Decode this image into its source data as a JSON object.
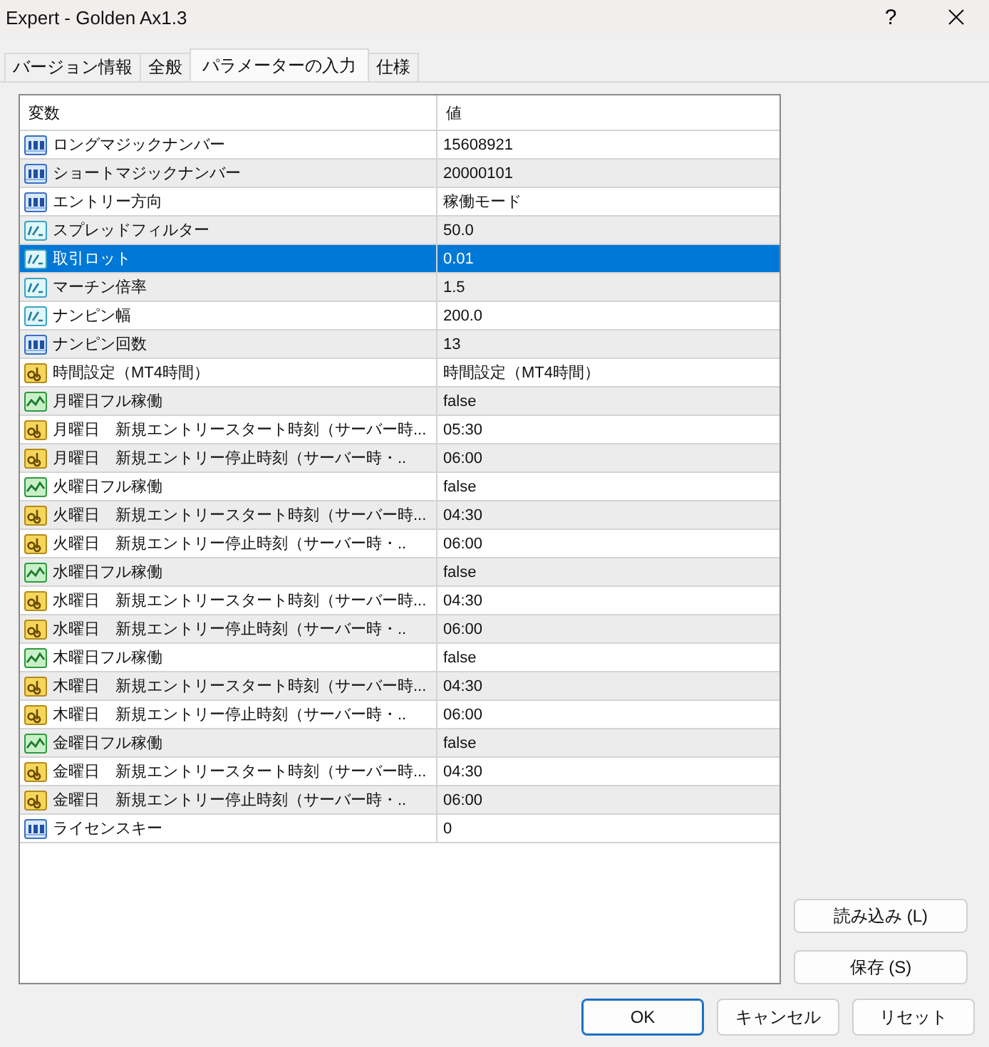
{
  "window": {
    "title": "Expert - Golden Ax1.3",
    "help_button": "?"
  },
  "tabs": [
    {
      "label": "バージョン情報",
      "selected": false
    },
    {
      "label": "全般",
      "selected": false
    },
    {
      "label": "パラメーターの入力",
      "selected": true
    },
    {
      "label": "仕様",
      "selected": false
    }
  ],
  "table": {
    "columns": [
      "変数",
      "値"
    ],
    "rows": [
      {
        "kind": "int",
        "name": "ロングマジックナンバー",
        "value": "15608921",
        "selected": false
      },
      {
        "kind": "int",
        "name": "ショートマジックナンバー",
        "value": "20000101",
        "selected": false
      },
      {
        "kind": "int",
        "name": "エントリー方向",
        "value": "稼働モード",
        "selected": false
      },
      {
        "kind": "double",
        "name": "スプレッドフィルター",
        "value": "50.0",
        "selected": false
      },
      {
        "kind": "double",
        "name": "取引ロット",
        "value": "0.01",
        "selected": true
      },
      {
        "kind": "double",
        "name": "マーチン倍率",
        "value": "1.5",
        "selected": false
      },
      {
        "kind": "double",
        "name": "ナンピン幅",
        "value": "200.0",
        "selected": false
      },
      {
        "kind": "int",
        "name": "ナンピン回数",
        "value": "13",
        "selected": false
      },
      {
        "kind": "string",
        "name": "時間設定（MT4時間）",
        "value": "時間設定（MT4時間）",
        "selected": false
      },
      {
        "kind": "bool",
        "name": "月曜日フル稼働",
        "value": "false",
        "selected": false
      },
      {
        "kind": "string",
        "name": "月曜日　新規エントリースタート時刻（サーバー時...",
        "value": "05:30",
        "selected": false
      },
      {
        "kind": "string",
        "name": "月曜日　新規エントリー停止時刻（サーバー時・..",
        "value": "06:00",
        "selected": false
      },
      {
        "kind": "bool",
        "name": "火曜日フル稼働",
        "value": "false",
        "selected": false
      },
      {
        "kind": "string",
        "name": "火曜日　新規エントリースタート時刻（サーバー時...",
        "value": "04:30",
        "selected": false
      },
      {
        "kind": "string",
        "name": "火曜日　新規エントリー停止時刻（サーバー時・..",
        "value": "06:00",
        "selected": false
      },
      {
        "kind": "bool",
        "name": "水曜日フル稼働",
        "value": "false",
        "selected": false
      },
      {
        "kind": "string",
        "name": "水曜日　新規エントリースタート時刻（サーバー時...",
        "value": "04:30",
        "selected": false
      },
      {
        "kind": "string",
        "name": "水曜日　新規エントリー停止時刻（サーバー時・..",
        "value": "06:00",
        "selected": false
      },
      {
        "kind": "bool",
        "name": "木曜日フル稼働",
        "value": "false",
        "selected": false
      },
      {
        "kind": "string",
        "name": "木曜日　新規エントリースタート時刻（サーバー時...",
        "value": "04:30",
        "selected": false
      },
      {
        "kind": "string",
        "name": "木曜日　新規エントリー停止時刻（サーバー時・..",
        "value": "06:00",
        "selected": false
      },
      {
        "kind": "bool",
        "name": "金曜日フル稼働",
        "value": "false",
        "selected": false
      },
      {
        "kind": "string",
        "name": "金曜日　新規エントリースタート時刻（サーバー時...",
        "value": "04:30",
        "selected": false
      },
      {
        "kind": "string",
        "name": "金曜日　新規エントリー停止時刻（サーバー時・..",
        "value": "06:00",
        "selected": false
      },
      {
        "kind": "int",
        "name": "ライセンスキー",
        "value": "0",
        "selected": false
      }
    ]
  },
  "side_buttons": [
    "読み込み (L)",
    "保存 (S)"
  ],
  "buttons": [
    {
      "label": "OK",
      "default": true
    },
    {
      "label": "キャンセル",
      "default": false
    },
    {
      "label": "リセット",
      "default": false
    }
  ]
}
